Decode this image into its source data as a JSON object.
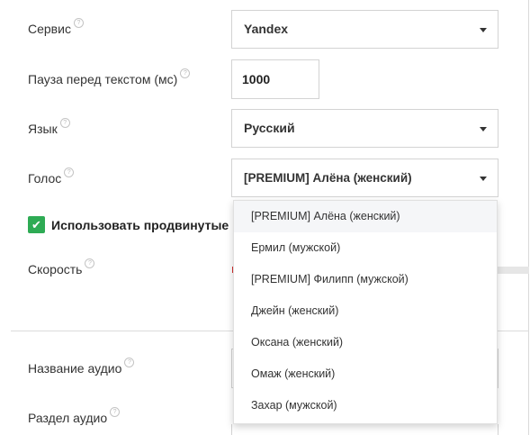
{
  "form": {
    "service": {
      "label": "Сервис",
      "value": "Yandex"
    },
    "pause": {
      "label": "Пауза перед текстом (мс)",
      "value": "1000"
    },
    "language": {
      "label": "Язык",
      "value": "Русский"
    },
    "voice": {
      "label": "Голос",
      "value": "[PREMIUM] Алёна (женский)"
    },
    "advanced": {
      "label": "Использовать продвинутые н",
      "checked": true
    },
    "speed": {
      "label": "Скорость"
    },
    "audio_name": {
      "label": "Название аудио"
    },
    "audio_section": {
      "label": "Раздел аудио"
    }
  },
  "voice_dropdown": {
    "options": [
      "[PREMIUM] Алёна (женский)",
      "Ермил (мужской)",
      "[PREMIUM] Филипп (мужской)",
      "Джейн (женский)",
      "Оксана (женский)",
      "Омаж (женский)",
      "Захар (мужской)"
    ],
    "highlighted_index": 0
  },
  "icons": {
    "help": "?",
    "check": "✔"
  },
  "colors": {
    "checkbox": "#2eab54",
    "slider_fill": "#d32f2f"
  }
}
